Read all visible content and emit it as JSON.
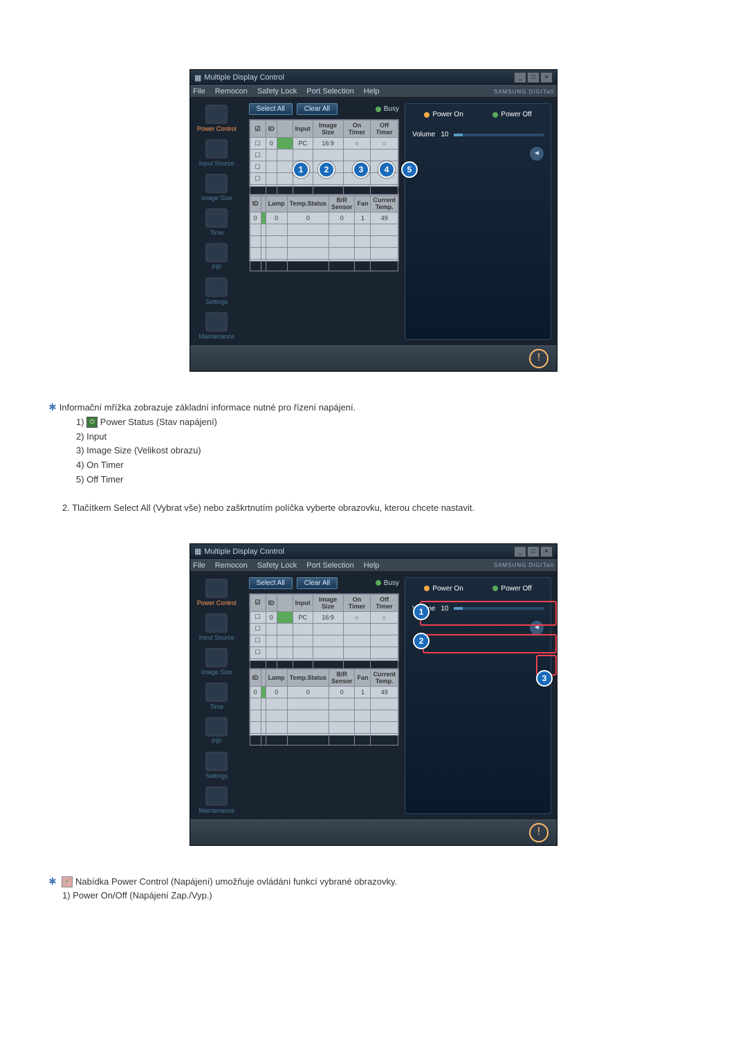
{
  "app": {
    "title": "Multiple Display Control",
    "brand": "SAMSUNG DIGITall"
  },
  "menu": [
    "File",
    "Remocon",
    "Safety Lock",
    "Port Selection",
    "Help"
  ],
  "sidebar": [
    {
      "label": "Power Control"
    },
    {
      "label": "Input Source"
    },
    {
      "label": "Image Size"
    },
    {
      "label": "Time"
    },
    {
      "label": "PIP"
    },
    {
      "label": "Settings"
    },
    {
      "label": "Maintenance"
    }
  ],
  "toolbar": {
    "selectAll": "Select All",
    "clearAll": "Clear All",
    "busy": "Busy"
  },
  "grid1": {
    "headers": [
      "",
      "ID",
      "",
      "Input",
      "Image Size",
      "On Timer",
      "Off Timer"
    ],
    "row": [
      "",
      "0",
      "",
      "PC",
      "16:9",
      "○",
      "○"
    ]
  },
  "grid2": {
    "headers": [
      "ID",
      "",
      "Lamp",
      "Temp.Status",
      "B/R Sensor",
      "Fan",
      "Current Temp."
    ],
    "row": [
      "0",
      "",
      "0",
      "0",
      "0",
      "1",
      "49"
    ]
  },
  "panel": {
    "powerOn": "Power On",
    "powerOff": "Power Off",
    "volumeLabel": "Volume",
    "volumeValue": "10"
  },
  "doc1": {
    "intro": "Informační mřížka zobrazuje základní informace nutné pro řízení napájení.",
    "items": [
      "Power Status (Stav napájení)",
      "Input",
      "Image Size (Velikost obrazu)",
      "On Timer",
      "Off Timer"
    ],
    "step2": "2. Tlačítkem Select All (Vybrat vše) nebo zaškrtnutím políčka vyberte obrazovku, kterou chcete nastavit."
  },
  "doc2": {
    "line1": "Nabídka Power Control (Napájení) umožňuje ovládání funkcí vybrané obrazovky.",
    "line2": "1) Power On/Off (Napájení Zap./Vyp.)"
  },
  "callouts1": [
    "1",
    "2",
    "3",
    "4",
    "5"
  ],
  "callouts2": [
    "1",
    "2",
    "3"
  ]
}
